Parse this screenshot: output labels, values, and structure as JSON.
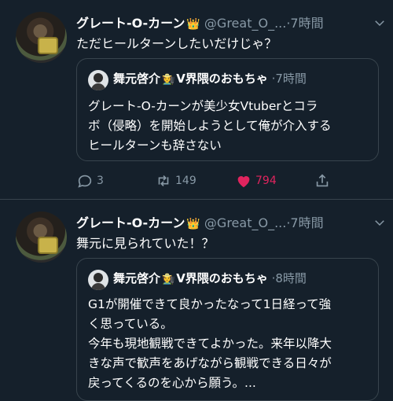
{
  "tweets": [
    {
      "author": {
        "name": "グレート-O-カーン",
        "badge": "👑",
        "handle": "@Great_O_...",
        "time": "7時間"
      },
      "text": "ただヒールターンしたいだけじゃ？",
      "quote": {
        "author": {
          "name": "舞元啓介",
          "emoji": "🧑‍🌾",
          "suffix": "V界隈のおもちゃ",
          "time": "7時間"
        },
        "lines": [
          "グレート-O-カーンが美少女Vtuberとコラ",
          "ボ（侵略）を開始しようとして俺が介入する",
          "ヒールターンも辞さない"
        ]
      },
      "actions": {
        "replies": "3",
        "retweets": "149",
        "likes": "794"
      }
    },
    {
      "author": {
        "name": "グレート-O-カーン",
        "badge": "👑",
        "handle": "@Great_O_...",
        "time": "7時間"
      },
      "text": "舞元に見られていた！？",
      "quote": {
        "author": {
          "name": "舞元啓介",
          "emoji": "🧑‍🌾",
          "suffix": "V界隈のおもちゃ",
          "time": "8時間"
        },
        "lines": [
          "G1が開催できて良かったなって1日経って強",
          "く思っている。",
          "今年も現地観戦できてよかった。来年以降大",
          "きな声で歓声をあげながら観戦できる日々が",
          "戻ってくるのを心から願う。..."
        ]
      }
    }
  ],
  "colors": {
    "background": "#15202b",
    "secondary": "#8899a6",
    "like": "#e0245e",
    "border": "#38444d"
  }
}
